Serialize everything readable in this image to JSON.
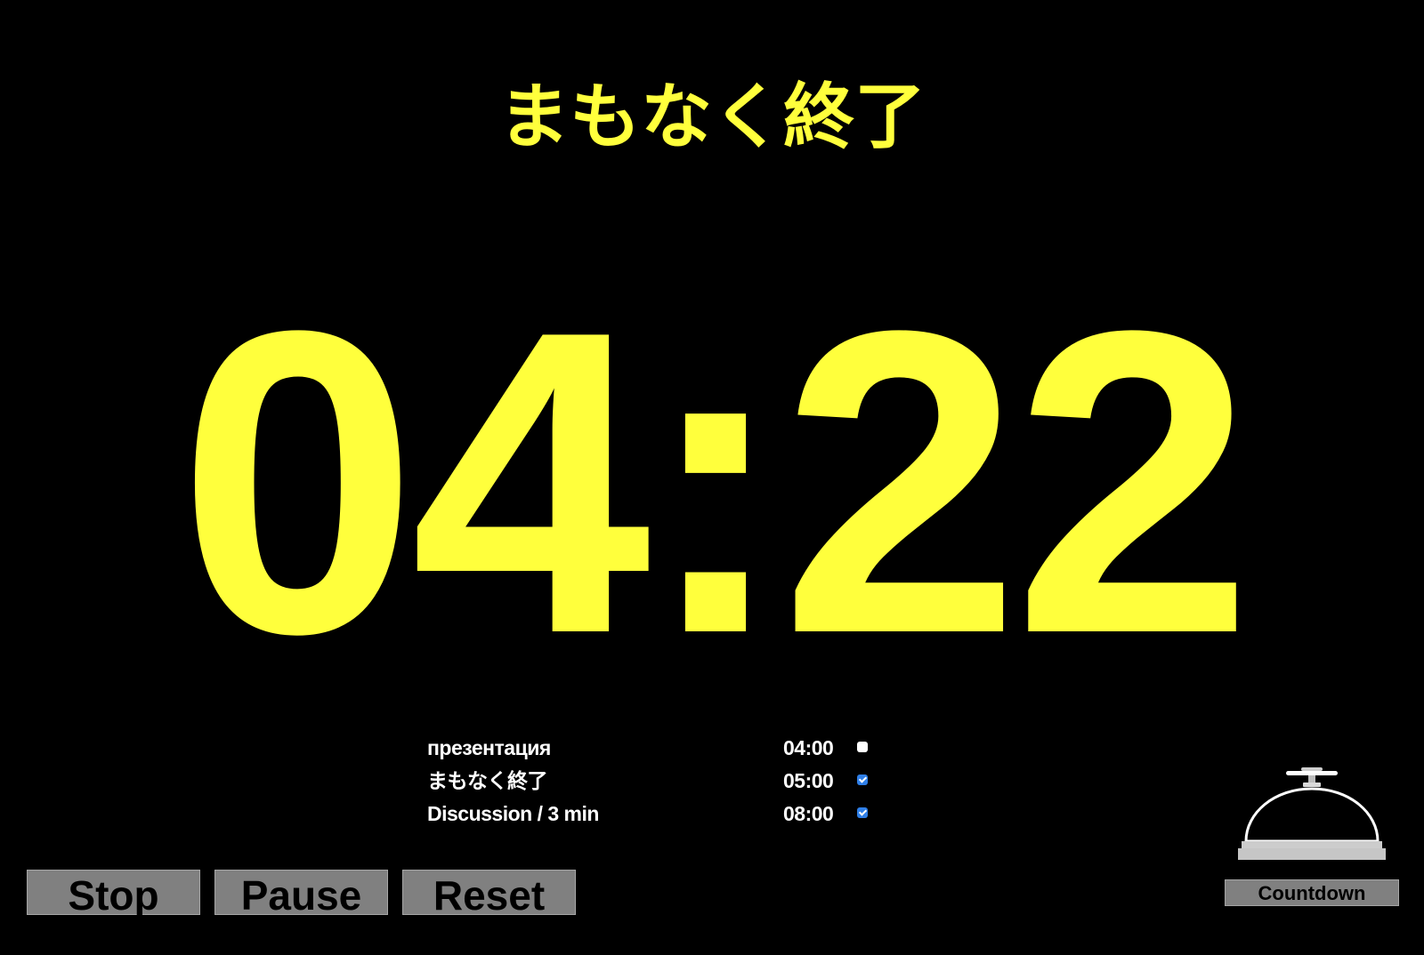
{
  "header": {
    "status_text": "まもなく終了"
  },
  "timer": {
    "display": "04:22"
  },
  "schedule": {
    "items": [
      {
        "label": "презентация",
        "time": "04:00",
        "checked": false
      },
      {
        "label": "まもなく終了",
        "time": "05:00",
        "checked": true
      },
      {
        "label": "Discussion / 3 min",
        "time": "08:00",
        "checked": true
      }
    ]
  },
  "controls": {
    "stop_label": "Stop",
    "pause_label": "Pause",
    "reset_label": "Reset",
    "countdown_label": "Countdown"
  },
  "colors": {
    "background": "#000000",
    "timer": "#ffff3c",
    "text": "#ffffff",
    "button": "#808080",
    "checkbox_checked": "#2f7fe8"
  },
  "icons": {
    "bell": "bell-icon"
  }
}
